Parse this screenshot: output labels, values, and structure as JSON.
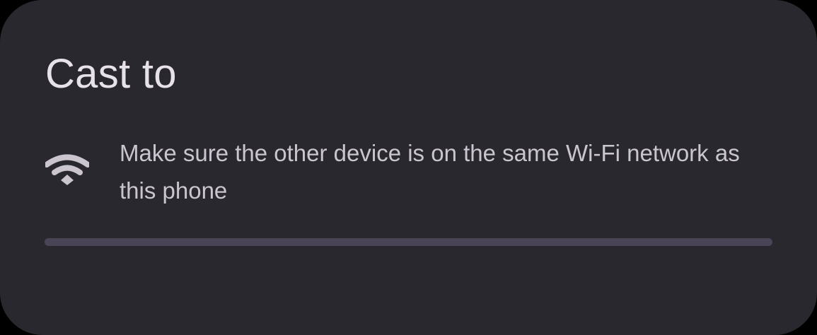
{
  "dialog": {
    "title": "Cast to",
    "info": {
      "icon": "wifi-icon",
      "message": "Make sure the other device is on the same Wi-Fi network as this phone"
    },
    "progress": {
      "indeterminate": true,
      "track_color": "#4a4457"
    }
  },
  "colors": {
    "surface": "#29282e",
    "title_text": "#e7e2ea",
    "body_text": "#cac5cf",
    "icon": "#cac5cf"
  }
}
